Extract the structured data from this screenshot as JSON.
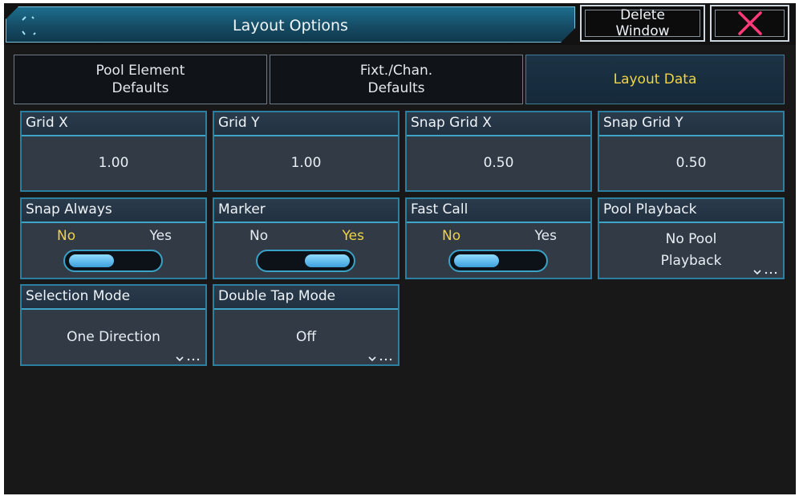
{
  "window": {
    "title": "Layout Options",
    "delete_label": "Delete\nWindow",
    "close_color": "#ff3a7a",
    "accent": "#2b7fa1",
    "active_text": "#f0d24a"
  },
  "tabs": [
    {
      "label": "Pool Element\nDefaults",
      "active": false
    },
    {
      "label": "Fixt./Chan.\nDefaults",
      "active": false
    },
    {
      "label": "Layout Data",
      "active": true
    }
  ],
  "fields": {
    "grid_x": {
      "label": "Grid X",
      "value": "1.00"
    },
    "grid_y": {
      "label": "Grid Y",
      "value": "1.00"
    },
    "snap_grid_x": {
      "label": "Snap Grid X",
      "value": "0.50"
    },
    "snap_grid_y": {
      "label": "Snap Grid Y",
      "value": "0.50"
    },
    "snap_always": {
      "label": "Snap Always",
      "no": "No",
      "yes": "Yes",
      "selected": "No"
    },
    "marker": {
      "label": "Marker",
      "no": "No",
      "yes": "Yes",
      "selected": "Yes"
    },
    "fast_call": {
      "label": "Fast Call",
      "no": "No",
      "yes": "Yes",
      "selected": "No"
    },
    "pool_playback": {
      "label": "Pool Playback",
      "value": "No Pool\nPlayback"
    },
    "selection_mode": {
      "label": "Selection Mode",
      "value": "One Direction"
    },
    "double_tap_mode": {
      "label": "Double Tap Mode",
      "value": "Off"
    }
  }
}
